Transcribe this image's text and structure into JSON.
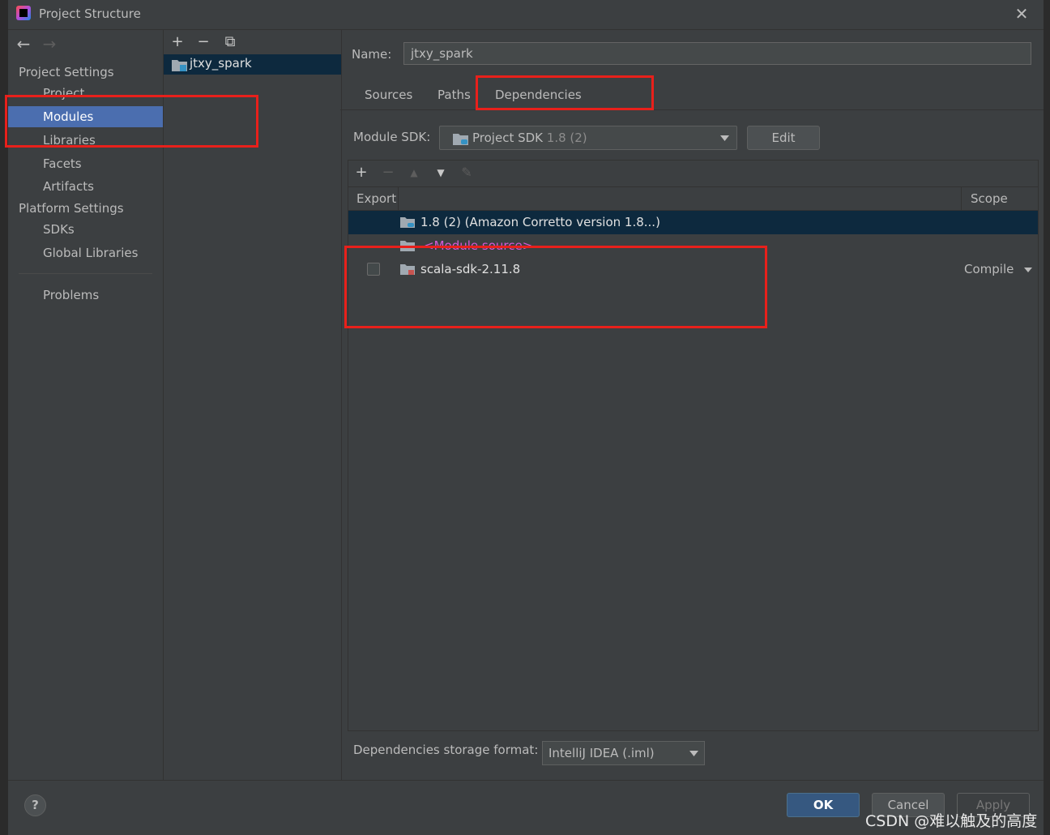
{
  "window": {
    "title": "Project Structure",
    "close_glyph": "✕"
  },
  "left_nav": {
    "back_glyph": "←",
    "forward_glyph": "→",
    "project_settings_header": "Project Settings",
    "project_settings_items": [
      {
        "label": "Project",
        "selected": false
      },
      {
        "label": "Modules",
        "selected": true
      },
      {
        "label": "Libraries",
        "selected": false
      },
      {
        "label": "Facets",
        "selected": false
      },
      {
        "label": "Artifacts",
        "selected": false
      }
    ],
    "platform_settings_header": "Platform Settings",
    "platform_settings_items": [
      {
        "label": "SDKs"
      },
      {
        "label": "Global Libraries"
      }
    ],
    "problems_label": "Problems"
  },
  "module_list": {
    "add_glyph": "+",
    "remove_glyph": "−",
    "copy_glyph": "⧉",
    "modules": [
      {
        "name": "jtxy_spark"
      }
    ]
  },
  "module_detail": {
    "name_label": "Name:",
    "name_value": "jtxy_spark",
    "tabs": [
      {
        "label": "Sources",
        "active": false
      },
      {
        "label": "Paths",
        "active": false
      },
      {
        "label": "Dependencies",
        "active": true
      }
    ],
    "sdk_label": "Module SDK:",
    "sdk_value": "Project SDK",
    "sdk_version": "1.8 (2)",
    "edit_label": "Edit"
  },
  "dependencies": {
    "toolbar": {
      "add": "+",
      "remove": "−",
      "up": "▲",
      "down": "▼",
      "edit": "✎"
    },
    "header_export": "Export",
    "header_scope": "Scope",
    "rows": [
      {
        "name": "1.8 (2) (Amazon Corretto version 1.8...)",
        "selected": true
      },
      {
        "name": "<Module source>",
        "selected": false
      },
      {
        "name": "scala-sdk-2.11.8",
        "export_checked": false,
        "scope": "Compile"
      }
    ]
  },
  "storage": {
    "label": "Dependencies storage format:",
    "value": "IntelliJ IDEA (.iml)"
  },
  "footer": {
    "help_label": "?",
    "ok_label": "OK",
    "cancel_label": "Cancel",
    "apply_label": "Apply"
  },
  "watermark": "CSDN @难以触及的高度",
  "colors": {
    "selection": "#4b6eaf",
    "row_selection": "#0d293e",
    "highlight_box": "#e8201b",
    "module_source": "#d65ad6",
    "library_red": "#c75450"
  }
}
